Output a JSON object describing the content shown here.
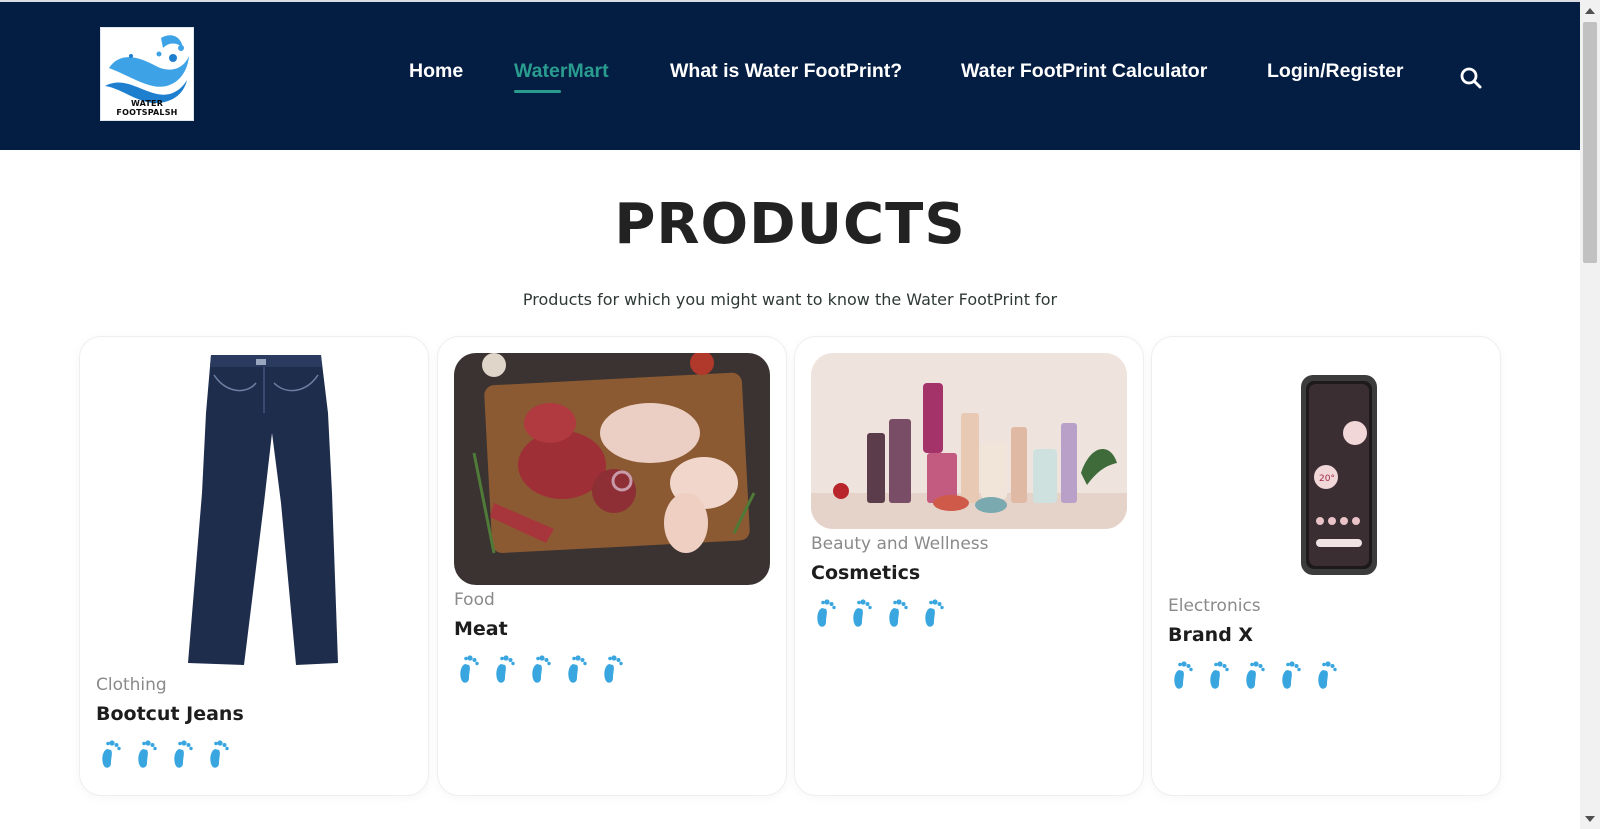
{
  "logo": {
    "text": "WATER FOOTSPALSH"
  },
  "nav": {
    "home": "Home",
    "watermart": "WaterMart",
    "what_is": "What is Water FootPrint?",
    "calculator": "Water FootPrint Calculator",
    "login": "Login/Register",
    "search_icon": "search-icon"
  },
  "page": {
    "title": "PRODUCTS",
    "subtitle": "Products for which you might want to know the Water FootPrint for"
  },
  "products": [
    {
      "category": "Clothing",
      "name": "Bootcut Jeans",
      "footprint_rating": 4,
      "icon": "jeans-image"
    },
    {
      "category": "Food",
      "name": "Meat",
      "footprint_rating": 5,
      "icon": "meat-image"
    },
    {
      "category": "Beauty and Wellness",
      "name": "Cosmetics",
      "footprint_rating": 4,
      "icon": "cosmetics-image"
    },
    {
      "category": "Electronics",
      "name": "Brand X",
      "footprint_rating": 5,
      "icon": "phone-image"
    }
  ],
  "colors": {
    "header_bg": "#041d43",
    "accent": "#2a9c8f",
    "foot_icon": "#3aa6e0"
  }
}
